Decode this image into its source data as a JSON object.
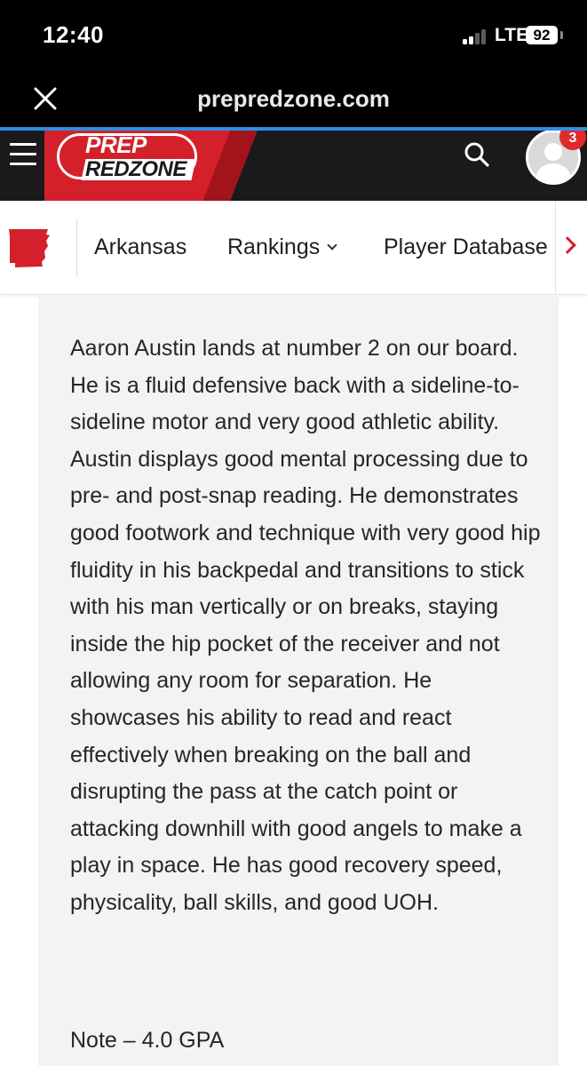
{
  "status_bar": {
    "time": "12:40",
    "network": "LTE",
    "battery": "92"
  },
  "browser": {
    "url": "prepredzone.com",
    "close_icon": "close-icon"
  },
  "site_header": {
    "logo_line1": "PREP",
    "logo_line2": "REDZONE",
    "menu_icon": "hamburger-menu-icon",
    "search_icon": "search-icon",
    "notification_count": "3",
    "colors": {
      "brand_red": "#d4202a",
      "header_bg": "#1a1a1a"
    }
  },
  "sub_nav": {
    "state_icon": "arkansas-state-icon",
    "items": [
      {
        "label": "Arkansas"
      },
      {
        "label": "Rankings"
      },
      {
        "label": "Player Database"
      }
    ],
    "more_icon": "chevron-right-icon"
  },
  "article": {
    "body": "Aaron Austin lands at number 2 on our board. He is a fluid defensive back with a sideline-to-sideline motor and very good athletic ability. Austin displays good mental processing due to pre- and post-snap reading. He demonstrates good footwork and technique with very good hip fluidity in his backpedal and transitions to stick with his man vertically or on breaks, staying inside the hip pocket of the receiver and not allowing any room for separation. He showcases his ability to read and react effectively when breaking on the ball and disrupting the pass at the catch point or attacking downhill with good angels to make a play in space. He has good recovery speed, physicality, ball skills, and good UOH.",
    "note": "Note – 4.0 GPA"
  }
}
